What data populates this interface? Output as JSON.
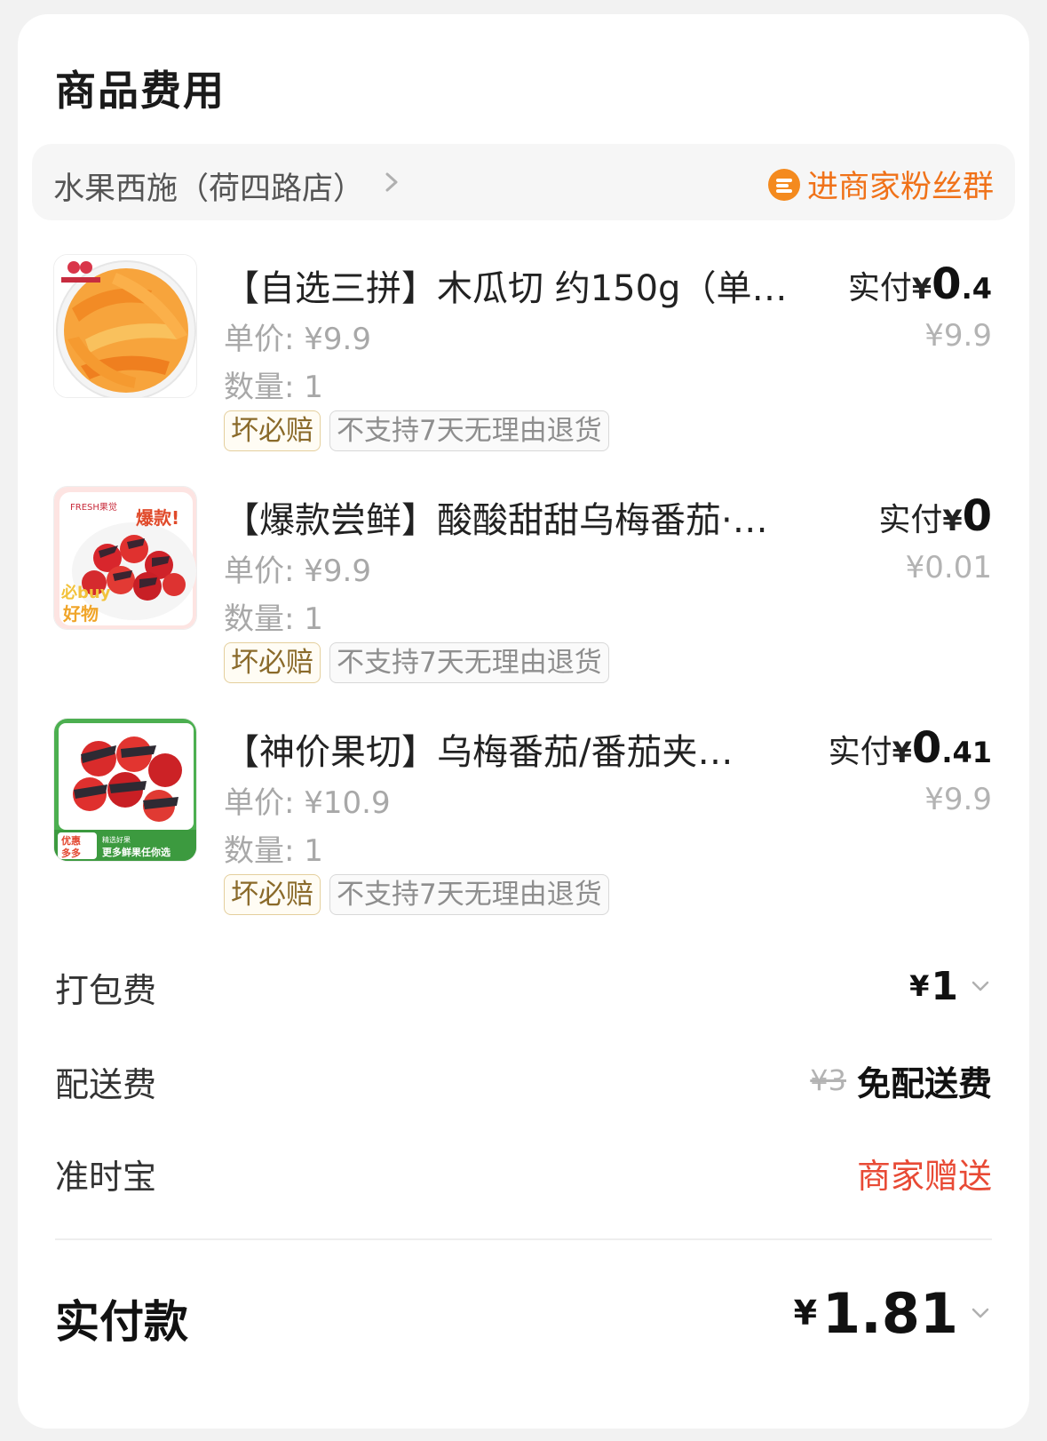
{
  "section": {
    "title": "商品费用"
  },
  "shop": {
    "name": "水果西施（荷四路店）",
    "fan_group_label": "进商家粉丝群",
    "accent_color": "#f07219"
  },
  "items": [
    {
      "title": "【自选三拼】木瓜切 约150g（单…",
      "paid_label": "实付",
      "paid_yen": "¥",
      "paid_int": "0",
      "paid_dec": ".4",
      "orig_price": "¥9.9",
      "unit_price": "单价: ¥9.9",
      "quantity": "数量: 1",
      "tags": [
        "坏必赔",
        "不支持7天无理由退货"
      ],
      "thumb_icon": "papaya-product-image"
    },
    {
      "title": "【爆款尝鲜】酸酸甜甜乌梅番茄·…",
      "paid_label": "实付",
      "paid_yen": "¥",
      "paid_int": "0",
      "paid_dec": "",
      "orig_price": "¥0.01",
      "unit_price": "单价: ¥9.9",
      "quantity": "数量: 1",
      "tags": [
        "坏必赔",
        "不支持7天无理由退货"
      ],
      "thumb_icon": "plum-tomato-product-image",
      "thumb_texts": [
        "FRESH果觉",
        "爆款!",
        "必buy",
        "好物"
      ]
    },
    {
      "title": "【神价果切】乌梅番茄/番茄夹…",
      "paid_label": "实付",
      "paid_yen": "¥",
      "paid_int": "0",
      "paid_dec": ".41",
      "orig_price": "¥9.9",
      "unit_price": "单价: ¥10.9",
      "quantity": "数量: 1",
      "tags": [
        "坏必赔",
        "不支持7天无理由退货"
      ],
      "thumb_icon": "tomato-snack-product-image",
      "thumb_texts": [
        "优惠",
        "多多",
        "精选好果",
        "更多鲜果任你选"
      ]
    }
  ],
  "fees": {
    "packing": {
      "label": "打包费",
      "yen": "¥",
      "value": "1"
    },
    "delivery": {
      "label": "配送费",
      "original": "¥3",
      "value": "免配送费"
    },
    "ontime": {
      "label": "准时宝",
      "value": "商家赠送",
      "color": "#e84a35"
    }
  },
  "total": {
    "label": "实付款",
    "yen": "¥",
    "value": "1.81"
  }
}
